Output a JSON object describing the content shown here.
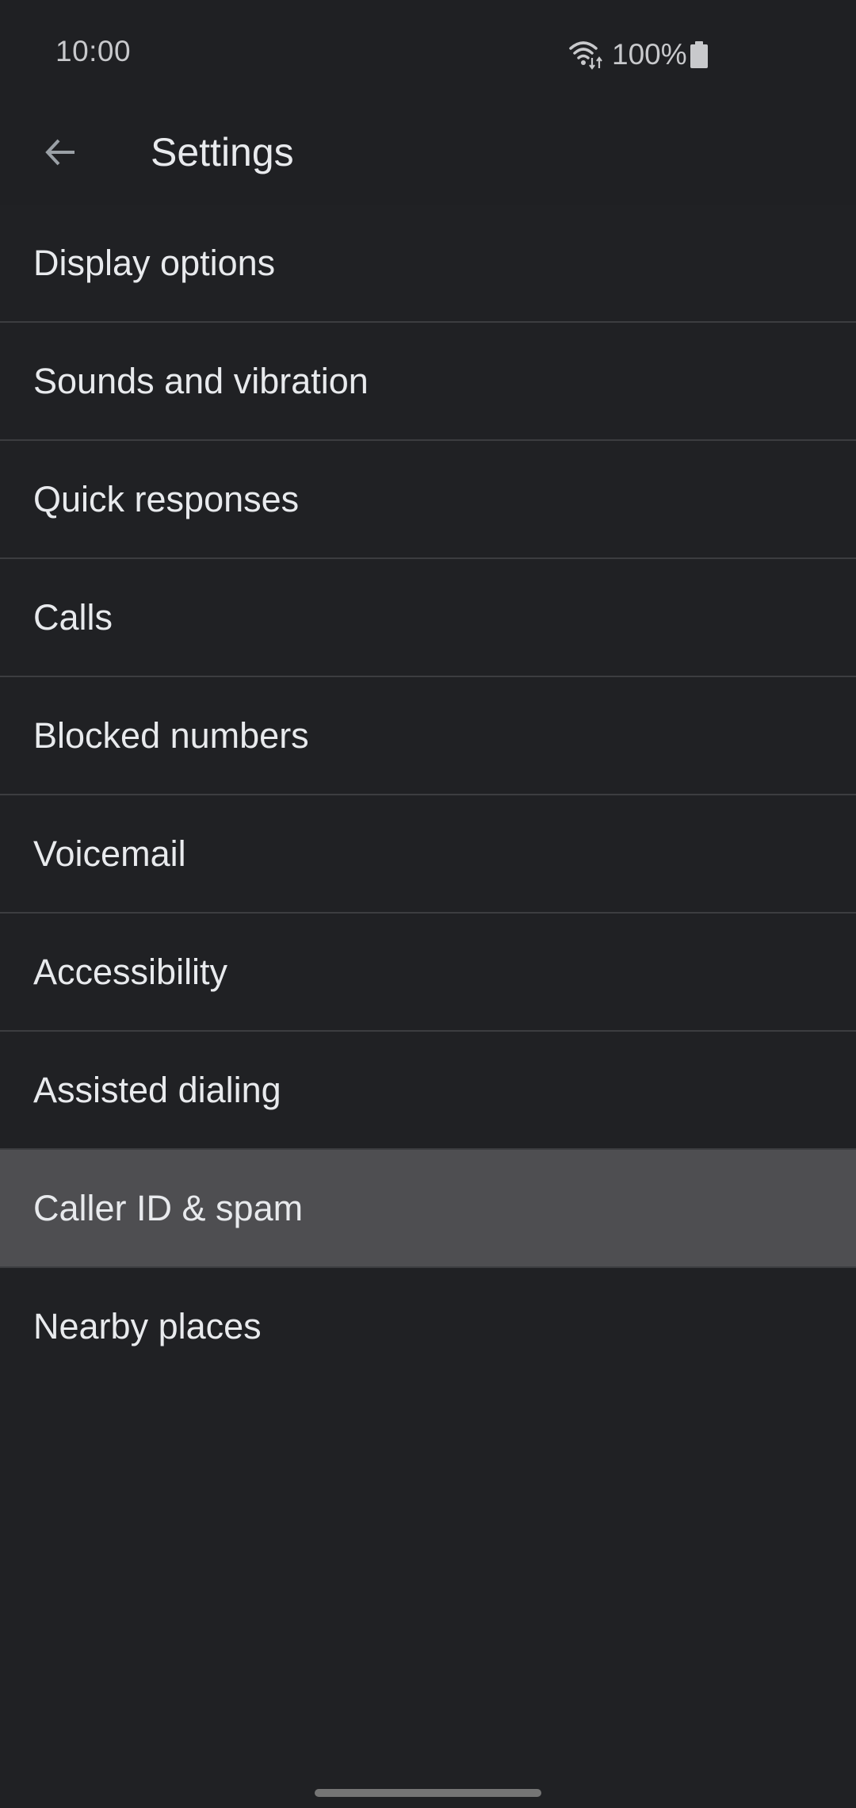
{
  "status_bar": {
    "time": "10:00",
    "wifi_icon": "wifi-data-activity-icon",
    "battery_percent": "100%",
    "battery_icon": "battery-full-icon"
  },
  "app_bar": {
    "back_icon": "arrow-back-icon",
    "title": "Settings"
  },
  "settings": {
    "items": [
      {
        "label": "Display options"
      },
      {
        "label": "Sounds and vibration"
      },
      {
        "label": "Quick responses"
      },
      {
        "label": "Calls"
      },
      {
        "label": "Blocked numbers"
      },
      {
        "label": "Voicemail"
      },
      {
        "label": "Accessibility"
      },
      {
        "label": "Assisted dialing"
      },
      {
        "label": "Caller ID & spam",
        "highlighted": true
      },
      {
        "label": "Nearby places"
      }
    ]
  },
  "colors": {
    "background": "#202124",
    "highlight": "#4e4e51",
    "divider": "#3c3d40",
    "text": "#e8eaed"
  }
}
